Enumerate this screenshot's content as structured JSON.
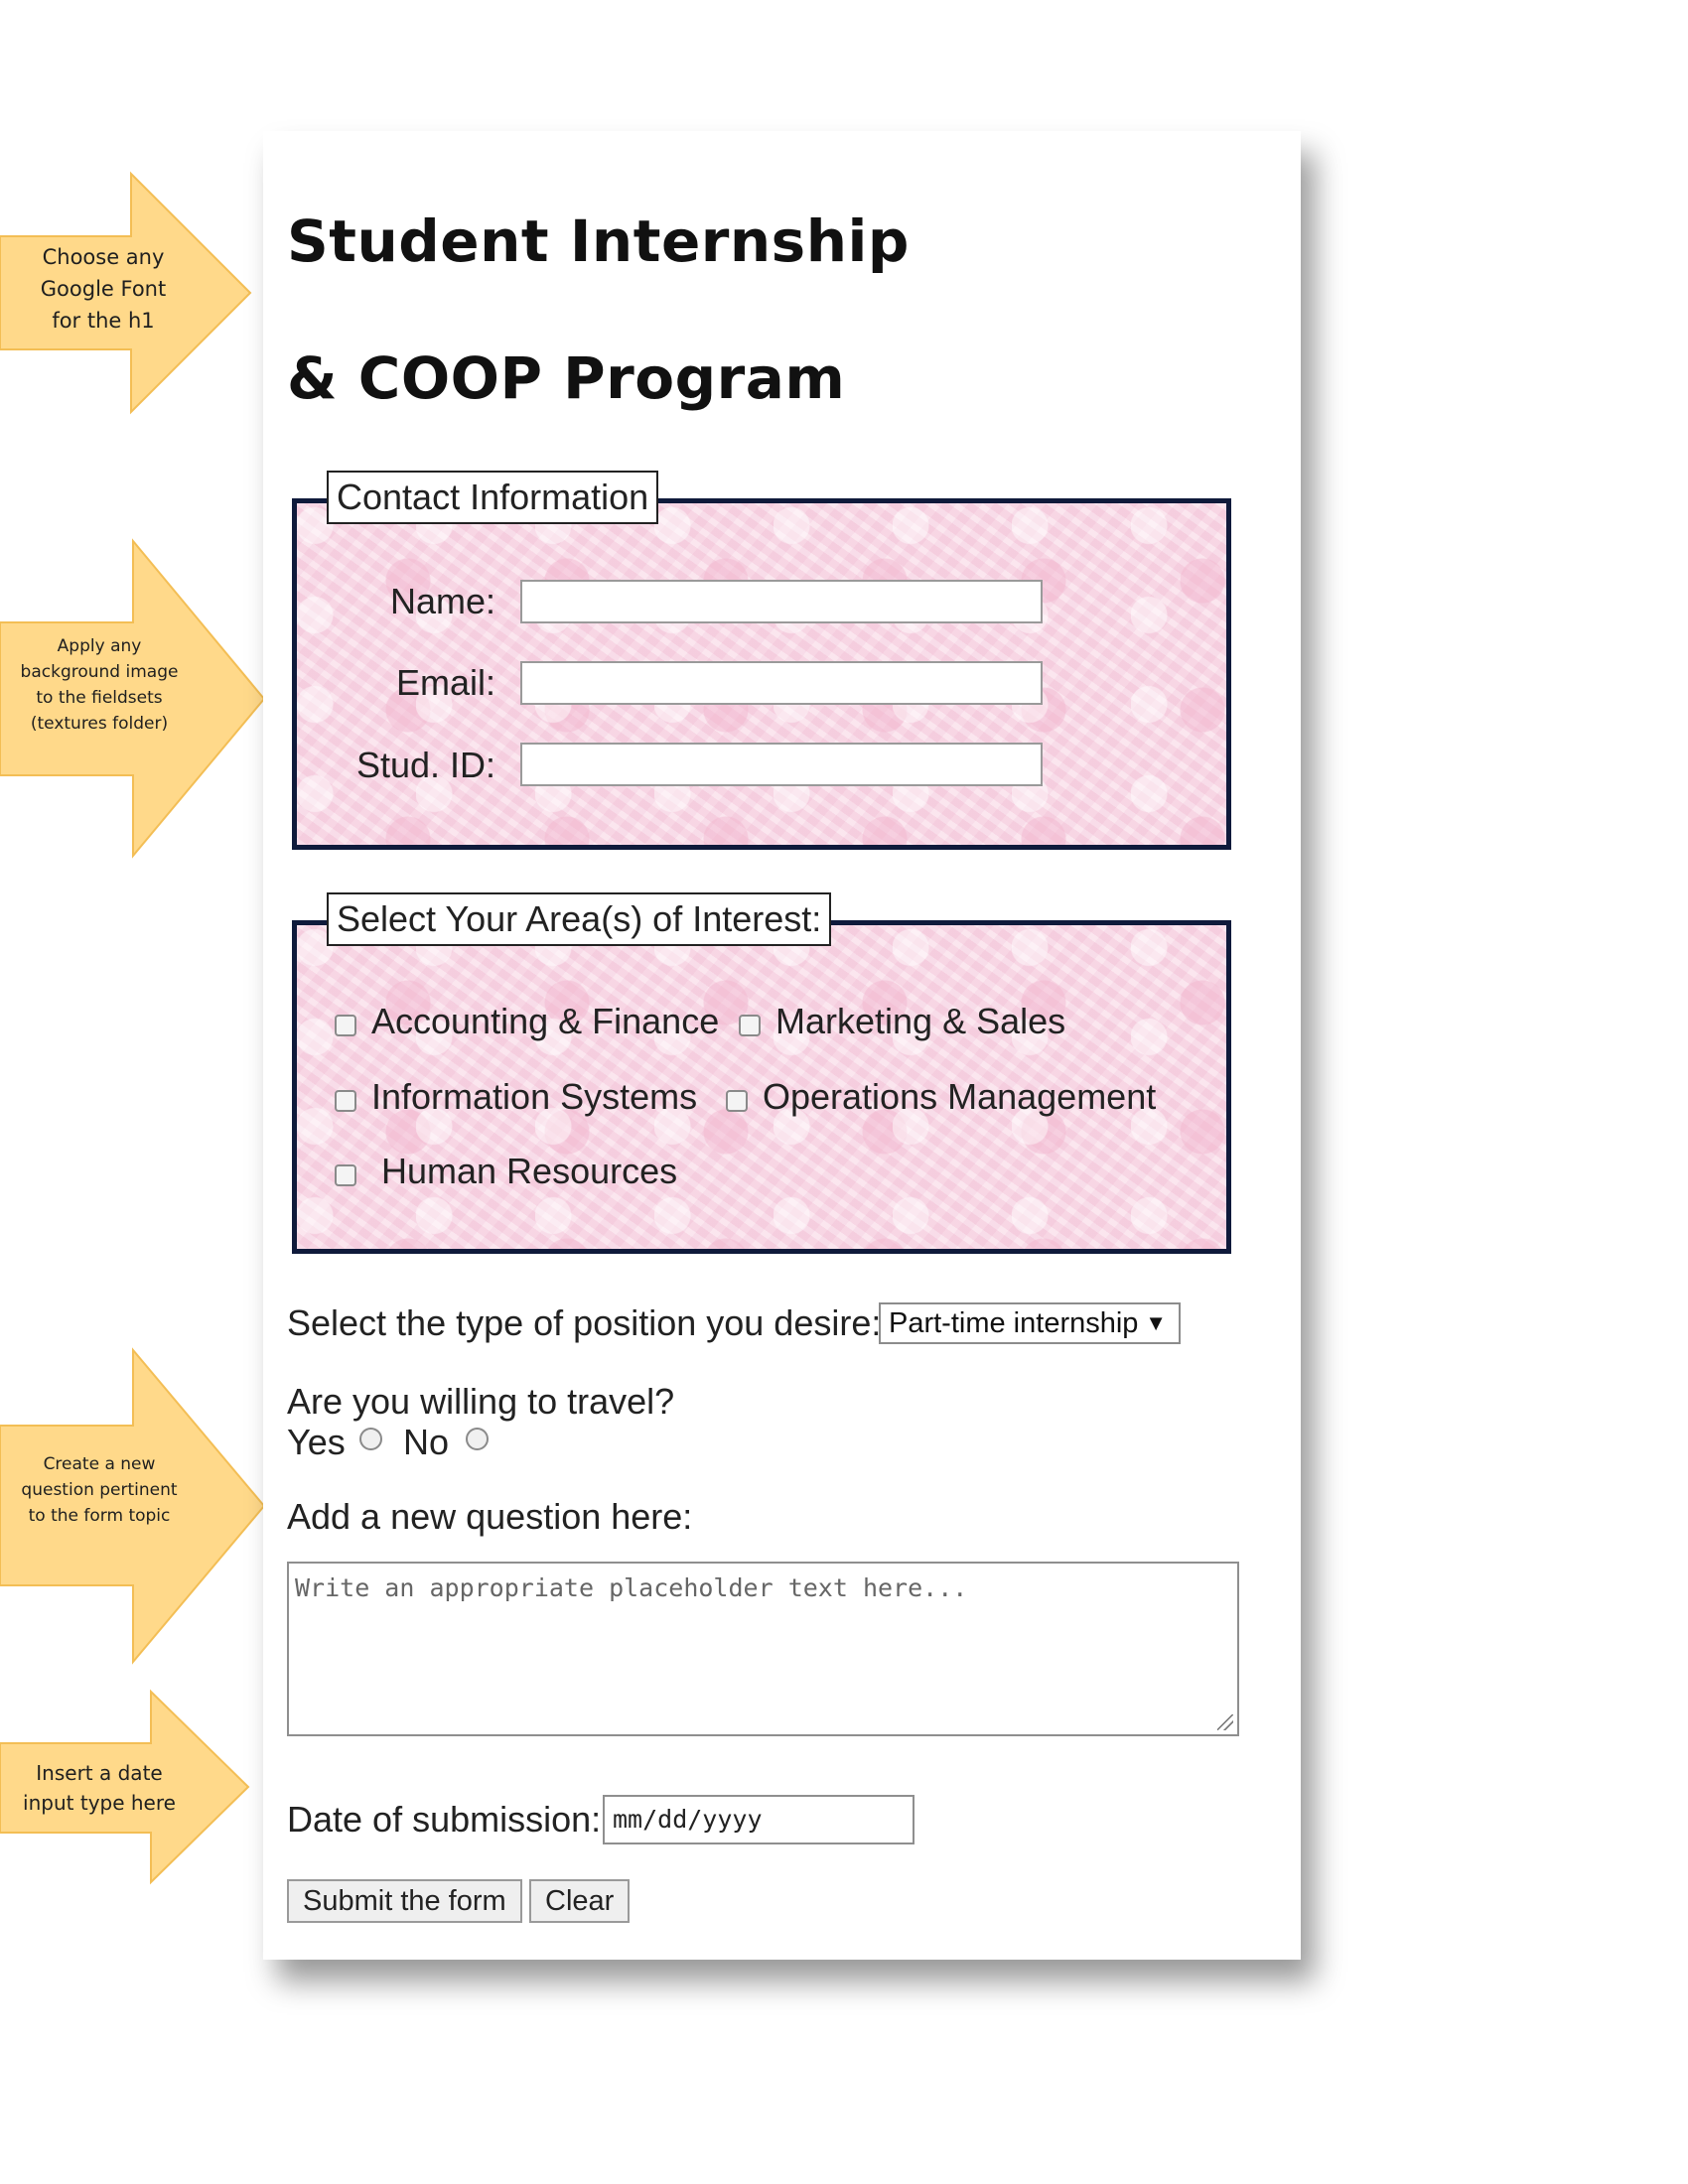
{
  "callouts": [
    {
      "text_lines": [
        "Choose any",
        "Google Font",
        "for the h1"
      ]
    },
    {
      "text_lines": [
        "Apply any",
        "background image",
        "to the fieldsets",
        "(textures folder)"
      ]
    },
    {
      "text_lines": [
        "Create a new",
        "question pertinent",
        "to the form topic"
      ]
    },
    {
      "text_lines": [
        "Insert a date",
        "input type here"
      ]
    }
  ],
  "form": {
    "heading_line1": "Student Internship",
    "heading_line2": "& COOP Program",
    "contact": {
      "legend": "Contact Information",
      "name_label": "Name:",
      "email_label": "Email:",
      "id_label": "Stud. ID:",
      "name_value": "",
      "email_value": "",
      "id_value": ""
    },
    "interests": {
      "legend": "Select Your Area(s) of Interest:",
      "options": [
        {
          "label": "Accounting & Finance",
          "checked": false
        },
        {
          "label": "Marketing & Sales",
          "checked": false
        },
        {
          "label": "Information Systems",
          "checked": false
        },
        {
          "label": "Operations Management",
          "checked": false
        },
        {
          "label": "Human Resources",
          "checked": false
        }
      ]
    },
    "position": {
      "label": "Select the type of position you desire:",
      "selected": "Part-time internship"
    },
    "travel": {
      "question": "Are you willing to travel?",
      "yes_label": "Yes",
      "no_label": "No"
    },
    "new_question": {
      "label": "Add a new question here:",
      "placeholder": "Write an appropriate placeholder text here..."
    },
    "date": {
      "label": "Date of submission:",
      "placeholder": "mm/dd/yyyy"
    },
    "buttons": {
      "submit": "Submit the form",
      "clear": "Clear"
    }
  },
  "colors": {
    "callout_fill": "#ffd98a",
    "fieldset_border": "#0f1a3b",
    "fieldset_texture": "#f9dbe8"
  },
  "icons": [
    "select-caret-icon",
    "resize-grip-icon"
  ]
}
